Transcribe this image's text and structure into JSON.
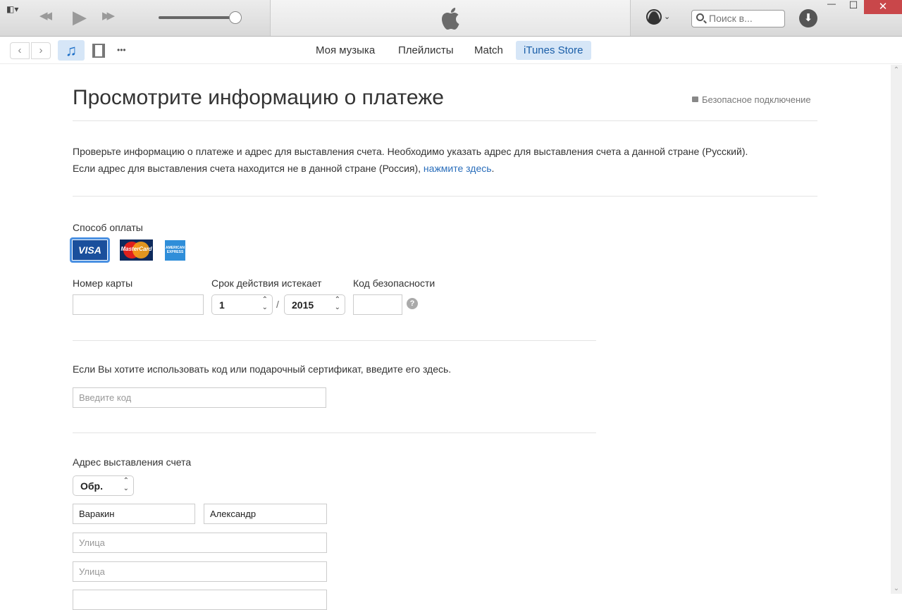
{
  "window": {
    "search_placeholder": "Поиск в...",
    "minimize": "—",
    "maximize": "☐",
    "close": "✕"
  },
  "player": {
    "rewind": "◀◀",
    "play": "▶",
    "forward": "▶▶",
    "volume_percent": 100
  },
  "toolbar": {
    "back": "‹",
    "forward": "›",
    "more": "•••",
    "tabs": [
      {
        "label": "Моя музыка",
        "active": false
      },
      {
        "label": "Плейлисты",
        "active": false
      },
      {
        "label": "Match",
        "active": false
      },
      {
        "label": "iTunes Store",
        "active": true
      }
    ]
  },
  "page": {
    "title": "Просмотрите информацию о платеже",
    "secure": "Безопасное подключение",
    "intro_line1": "Проверьте информацию о платеже и адрес для выставления счета. Необходимо указать адрес для выставления счета а данной стране (Русский).",
    "intro_line2": "Если адрес для выставления счета находится не в данной стране (Россия), ",
    "intro_link": "нажмите здесь",
    "intro_end": ".",
    "payment_label": "Способ оплаты",
    "cards": [
      {
        "name": "VISA",
        "selected": true
      },
      {
        "name": "MasterCard",
        "selected": false
      },
      {
        "name": "American Express",
        "selected": false
      }
    ],
    "card_number_label": "Номер карты",
    "card_number_value": "",
    "expiry_label": "Срок действия истекает",
    "expiry_month": "1",
    "expiry_sep": "/",
    "expiry_year": "2015",
    "cvv_label": "Код безопасности",
    "cvv_help": "?",
    "code_text": "Если Вы хотите использовать код или подарочный сертификат, введите его здесь.",
    "code_placeholder": "Введите код",
    "billing_label": "Адрес выставления счета",
    "salutation": "Обр.",
    "last_name": "Варакин",
    "first_name": "Александр",
    "street1_placeholder": "Улица",
    "street2_placeholder": "Улица"
  }
}
